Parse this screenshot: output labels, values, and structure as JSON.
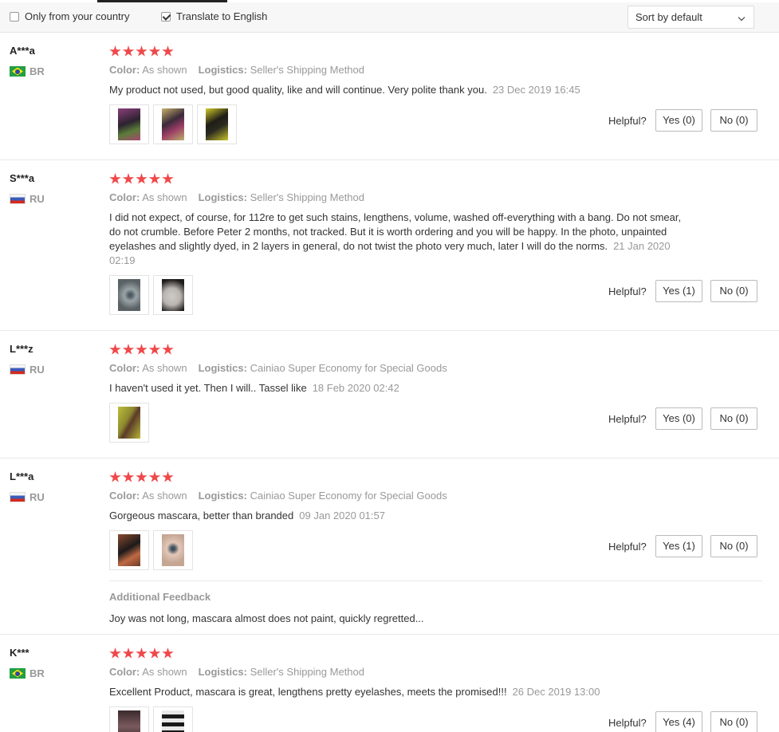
{
  "filters": {
    "only_country_label": "Only from your country",
    "only_country_checked": false,
    "translate_label": "Translate to English",
    "translate_checked": true,
    "sort_value": "Sort by default"
  },
  "labels": {
    "color": "Color:",
    "logistics": "Logistics:",
    "helpful": "Helpful?",
    "additional_feedback": "Additional Feedback"
  },
  "reviews": [
    {
      "user": "A***a",
      "country": "BR",
      "rating": 5,
      "color": "As shown",
      "logistics": "Seller's Shipping Method",
      "text": "My product not used, but good quality, like and will continue. Very polite thank you.",
      "date": "23 Dec 2019 16:45",
      "yes": "Yes (0)",
      "no": "No (0)"
    },
    {
      "user": "S***a",
      "country": "RU",
      "rating": 5,
      "color": "As shown",
      "logistics": "Seller's Shipping Method",
      "text": "I did not expect, of course, for 112re to get such stains, lengthens, volume, washed off-everything with a bang. Do not smear, do not crumble. Before Peter 2 months, not tracked. But it is worth ordering and you will be happy. In the photo, unpainted eyelashes and slightly dyed, in 2 layers in general, do not twist the photo very much, later I will do the norms.",
      "date": "21 Jan 2020 02:19",
      "yes": "Yes (1)",
      "no": "No (0)"
    },
    {
      "user": "L***z",
      "country": "RU",
      "rating": 5,
      "color": "As shown",
      "logistics": "Cainiao Super Economy for Special Goods",
      "text": "I haven't used it yet. Then I will.. Tassel like",
      "date": "18 Feb 2020 02:42",
      "yes": "Yes (0)",
      "no": "No (0)"
    },
    {
      "user": "L***a",
      "country": "RU",
      "rating": 5,
      "color": "As shown",
      "logistics": "Cainiao Super Economy for Special Goods",
      "text": "Gorgeous mascara, better than branded",
      "date": "09 Jan 2020 01:57",
      "yes": "Yes (1)",
      "no": "No (0)",
      "additional_feedback": "Joy was not long, mascara almost does not paint, quickly regretted..."
    },
    {
      "user": "K***",
      "country": "BR",
      "rating": 5,
      "color": "As shown",
      "logistics": "Seller's Shipping Method",
      "text": "Excellent Product, mascara is great, lengthens pretty eyelashes, meets the promised!!!",
      "date": "26 Dec 2019 13:00",
      "yes": "Yes (4)",
      "no": "No (0)"
    }
  ],
  "colors": {
    "star": "#f0484a",
    "muted": "#999999",
    "text": "#333333",
    "filter_bg": "#f7f7f7"
  }
}
